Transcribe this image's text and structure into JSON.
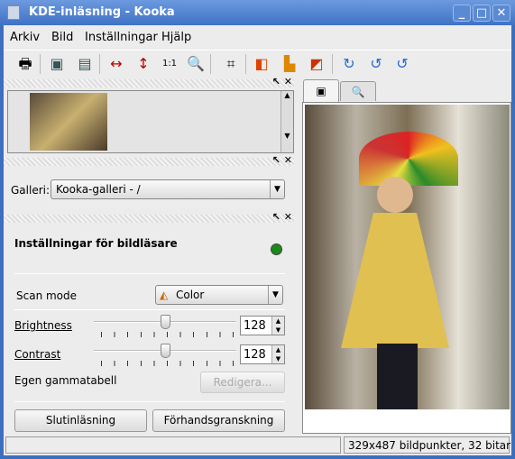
{
  "window": {
    "title": "KDE-inläsning - Kooka",
    "minimize": "_",
    "maximize": "□",
    "close": "✕"
  },
  "menu": [
    "Arkiv",
    "Bild",
    "Inställningar",
    "Hjälp"
  ],
  "toolbar": [
    "printer-icon",
    "save-image-icon",
    "save-selection-icon",
    "fit-width-icon",
    "fit-height-icon",
    "original-size-icon",
    "zoom-icon",
    "crop-icon",
    "mirror-vertical-icon",
    "mirror-horizontal-icon",
    "mirror-both-icon",
    "rotate-clockwise-icon",
    "rotate-counterclockwise-icon",
    "rotate-180-icon"
  ],
  "gallery": {
    "label": "Galleri:",
    "value": "Kooka-galleri - /"
  },
  "scanner": {
    "title": "Inställningar för bildläsare",
    "status_color": "#1a8a1a",
    "scan_mode_label": "Scan mode",
    "scan_mode_value": "Color",
    "brightness_label": "Brightness",
    "brightness_value": "128",
    "contrast_label": "Contrast",
    "contrast_value": "128",
    "gamma_label": "Egen gammatabell",
    "gamma_button": "Redigera...",
    "final_scan": "Slutinläsning",
    "preview": "Förhandsgranskning"
  },
  "status": {
    "left": "",
    "right": "329x487 bildpunkter, 32 bitar"
  }
}
